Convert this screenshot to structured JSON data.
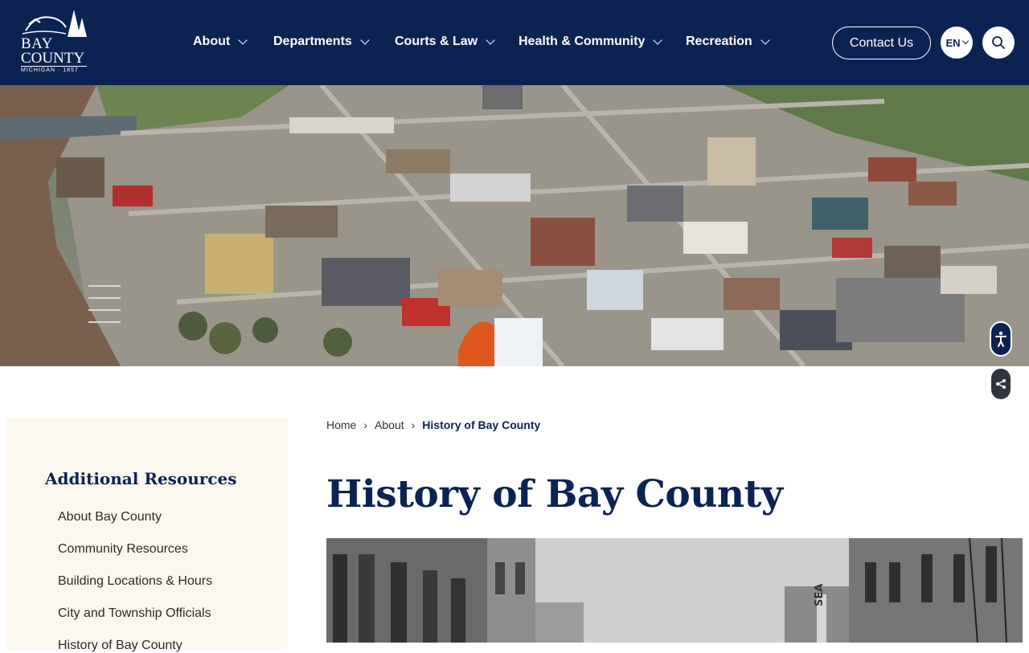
{
  "header": {
    "logo": {
      "line1": "BAY",
      "line2": "COUNTY",
      "line3": "MICHIGAN · 1857"
    },
    "nav": [
      {
        "label": "About"
      },
      {
        "label": "Departments"
      },
      {
        "label": "Courts & Law"
      },
      {
        "label": "Health & Community"
      },
      {
        "label": "Recreation"
      }
    ],
    "contact_label": "Contact Us",
    "language": "EN"
  },
  "hero": {
    "image": "aerial photo of downtown Bay City with river"
  },
  "sidebar": {
    "title": "Additional Resources",
    "links": [
      {
        "label": "About Bay County"
      },
      {
        "label": "Community Resources"
      },
      {
        "label": "Building Locations & Hours"
      },
      {
        "label": "City and Township Officials"
      },
      {
        "label": "History of Bay County"
      }
    ]
  },
  "breadcrumb": [
    {
      "label": "Home"
    },
    {
      "label": "About"
    },
    {
      "label": "History of Bay County"
    }
  ],
  "page": {
    "title": "History of Bay County",
    "photo_sign": "SEA"
  },
  "colors": {
    "navy": "#0b2352",
    "sidebar_bg": "#fdf8ef"
  }
}
